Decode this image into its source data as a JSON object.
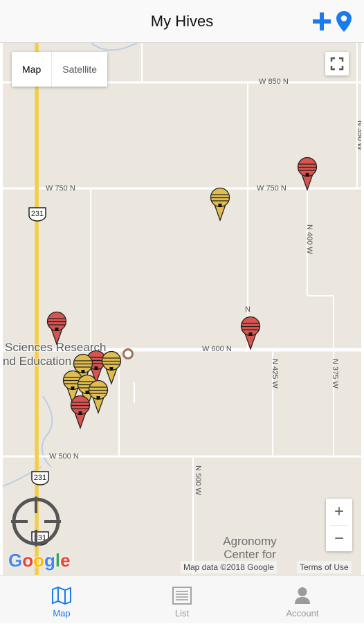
{
  "header": {
    "title": "My Hives",
    "add_icon": "plus-icon",
    "location_icon": "map-pin-icon",
    "accent": "#1a7bea"
  },
  "map": {
    "type_options": [
      {
        "label": "Map",
        "selected": true
      },
      {
        "label": "Satellite",
        "selected": false
      }
    ],
    "road_labels": {
      "w850": "W 850 N",
      "w750_left": "W 750 N",
      "w750_right": "W 750 N",
      "w600": "W 600 N",
      "w500": "W 500 N",
      "n350": "N 350 W",
      "n400": "N 400 W",
      "n425": "N 425 W",
      "n375": "N 375 W",
      "n500": "N 500 W",
      "n_short": "N"
    },
    "shields": {
      "s1": "231",
      "s2": "231",
      "s3": "231"
    },
    "place_line1": "Sciences Research",
    "place_line2": "nd Education",
    "agronomy_line1": "Agronomy",
    "agronomy_line2": "Center for",
    "zoom_in": "+",
    "zoom_out": "−",
    "google_logo": "Google",
    "attribution": "Map data ©2018 Google",
    "terms": "Terms of Use",
    "marker_colors": {
      "red": "#d9534f",
      "yellow": "#e1bd4f"
    }
  },
  "tabs": [
    {
      "label": "Map",
      "icon": "map-icon",
      "active": true
    },
    {
      "label": "List",
      "icon": "list-icon",
      "active": false
    },
    {
      "label": "Account",
      "icon": "account-icon",
      "active": false
    }
  ]
}
